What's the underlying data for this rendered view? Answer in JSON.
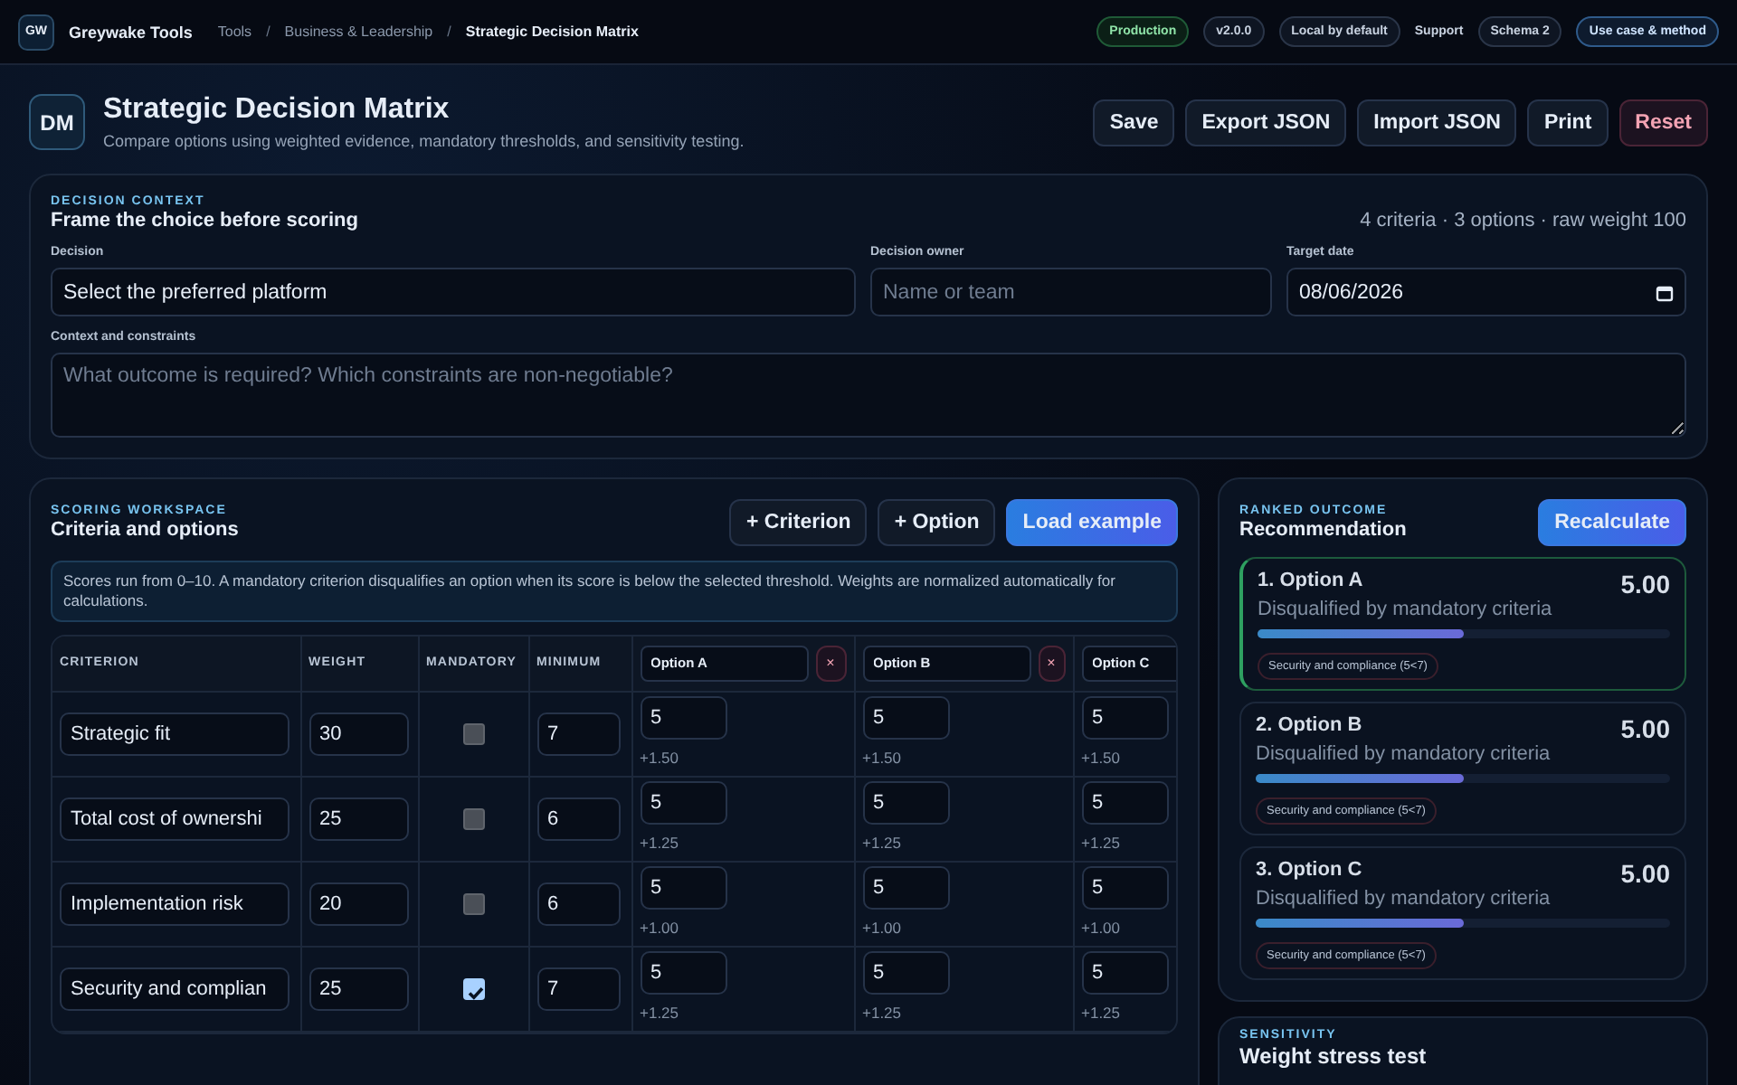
{
  "topbar": {
    "logo": "GW",
    "brand": "Greywake Tools",
    "breadcrumbs": [
      {
        "label": "Tools",
        "current": false
      },
      {
        "label": "Business & Leadership",
        "current": false
      },
      {
        "label": "Strategic Decision Matrix",
        "current": true
      }
    ],
    "badges": [
      {
        "label": "Production",
        "kind": "status"
      },
      {
        "label": "v2.0.0",
        "kind": "pill"
      },
      {
        "label": "Local by default",
        "kind": "pill"
      },
      {
        "label": "Support",
        "kind": "link"
      },
      {
        "label": "Schema 2",
        "kind": "pill"
      },
      {
        "label": "Use case & method",
        "kind": "accent"
      }
    ],
    "separator": "/"
  },
  "header": {
    "logo": "DM",
    "title": "Strategic Decision Matrix",
    "subtitle": "Compare options using weighted evidence, mandatory thresholds, and sensitivity testing.",
    "actions": [
      {
        "label": "Save",
        "kind": "default"
      },
      {
        "label": "Export JSON",
        "kind": "default"
      },
      {
        "label": "Import JSON",
        "kind": "default"
      },
      {
        "label": "Print",
        "kind": "default"
      },
      {
        "label": "Reset",
        "kind": "danger"
      }
    ]
  },
  "context": {
    "eyebrow": "DECISION CONTEXT",
    "title": "Frame the choice before scoring",
    "summary": "4 criteria · 3 options · raw weight 100",
    "decision": {
      "label": "Decision",
      "value": "Select the preferred platform"
    },
    "owner": {
      "label": "Decision owner",
      "placeholder": "Name or team"
    },
    "date": {
      "label": "Target date",
      "value": "08/06/2026"
    },
    "constraints": {
      "label": "Context and constraints",
      "placeholder": "What outcome is required? Which constraints are non-negotiable?"
    }
  },
  "workspace": {
    "eyebrow": "SCORING WORKSPACE",
    "title": "Criteria and options",
    "actions": [
      {
        "label": "+ Criterion",
        "kind": "default"
      },
      {
        "label": "+ Option",
        "kind": "default"
      },
      {
        "label": "Load example",
        "kind": "primary"
      }
    ],
    "note": "Scores run from 0–10. A mandatory criterion disqualifies an option when its score is below the selected threshold. Weights are normalized automatically for calculations.",
    "columns": [
      "CRITERION",
      "WEIGHT",
      "MANDATORY",
      "MINIMUM"
    ],
    "options": [
      {
        "name": "Option A",
        "remove": "×"
      },
      {
        "name": "Option B",
        "remove": "×"
      },
      {
        "name": "Option C"
      }
    ],
    "criteria": [
      {
        "name": "Strategic fit",
        "weight": "30",
        "mandatory": false,
        "minimum": "7",
        "scores": [
          {
            "score": "5",
            "contribution": "+1.50"
          },
          {
            "score": "5",
            "contribution": "+1.50"
          },
          {
            "score": "5",
            "contribution": "+1.50"
          }
        ]
      },
      {
        "name": "Total cost of ownershi",
        "weight": "25",
        "mandatory": false,
        "minimum": "6",
        "scores": [
          {
            "score": "5",
            "contribution": "+1.25"
          },
          {
            "score": "5",
            "contribution": "+1.25"
          },
          {
            "score": "5",
            "contribution": "+1.25"
          }
        ]
      },
      {
        "name": "Implementation risk",
        "weight": "20",
        "mandatory": false,
        "minimum": "6",
        "scores": [
          {
            "score": "5",
            "contribution": "+1.00"
          },
          {
            "score": "5",
            "contribution": "+1.00"
          },
          {
            "score": "5",
            "contribution": "+1.00"
          }
        ]
      },
      {
        "name": "Security and complian",
        "weight": "25",
        "mandatory": true,
        "minimum": "7",
        "scores": [
          {
            "score": "5",
            "contribution": "+1.25"
          },
          {
            "score": "5",
            "contribution": "+1.25"
          },
          {
            "score": "5",
            "contribution": "+1.25"
          }
        ]
      }
    ]
  },
  "outcome": {
    "eyebrow": "RANKED OUTCOME",
    "title": "Recommendation",
    "action": "Recalculate",
    "results": [
      {
        "name": "1. Option A",
        "score": "5.00",
        "status": "Disqualified by mandatory criteria",
        "level": 0.5,
        "selected": true,
        "flags": [
          "Security and compliance (5<7)"
        ]
      },
      {
        "name": "2. Option B",
        "score": "5.00",
        "status": "Disqualified by mandatory criteria",
        "level": 0.5,
        "selected": false,
        "flags": [
          "Security and compliance (5<7)"
        ]
      },
      {
        "name": "3. Option C",
        "score": "5.00",
        "status": "Disqualified by mandatory criteria",
        "level": 0.5,
        "selected": false,
        "flags": [
          "Security and compliance (5<7)"
        ]
      }
    ]
  },
  "sensitivity": {
    "eyebrow": "SENSITIVITY",
    "title": "Weight stress test"
  }
}
